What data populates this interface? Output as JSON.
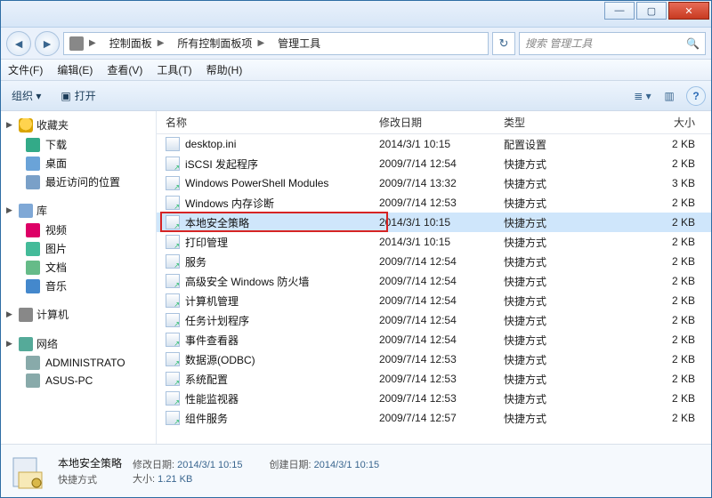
{
  "window": {
    "min_label": "—",
    "max_label": "▢",
    "close_label": "✕"
  },
  "address": {
    "root_icon": "control-panel-icon",
    "crumbs": [
      "控制面板",
      "所有控制面板项",
      "管理工具"
    ],
    "refresh_label": "↻",
    "search_placeholder": "搜索 管理工具",
    "search_icon": "🔍"
  },
  "menubar": [
    "文件(F)",
    "编辑(E)",
    "查看(V)",
    "工具(T)",
    "帮助(H)"
  ],
  "toolbar": {
    "organize": "组织 ▾",
    "open": "打开",
    "open_icon": "▣",
    "view_icon": "≣ ▾",
    "help_icon": "?"
  },
  "nav": {
    "favorites": {
      "label": "收藏夹",
      "items": [
        "下载",
        "桌面",
        "最近访问的位置"
      ]
    },
    "libraries": {
      "label": "库",
      "items": [
        "视频",
        "图片",
        "文档",
        "音乐"
      ]
    },
    "computer": {
      "label": "计算机"
    },
    "network": {
      "label": "网络",
      "items": [
        "ADMINISTRATO",
        "ASUS-PC"
      ]
    }
  },
  "columns": {
    "name": "名称",
    "date": "修改日期",
    "type": "类型",
    "size": "大小"
  },
  "files": [
    {
      "name": "desktop.ini",
      "date": "2014/3/1 10:15",
      "type": "配置设置",
      "size": "2 KB",
      "icon": "file"
    },
    {
      "name": "iSCSI 发起程序",
      "date": "2009/7/14 12:54",
      "type": "快捷方式",
      "size": "2 KB",
      "icon": "lnk"
    },
    {
      "name": "Windows PowerShell Modules",
      "date": "2009/7/14 13:32",
      "type": "快捷方式",
      "size": "3 KB",
      "icon": "lnk"
    },
    {
      "name": "Windows 内存诊断",
      "date": "2009/7/14 12:53",
      "type": "快捷方式",
      "size": "2 KB",
      "icon": "lnk"
    },
    {
      "name": "本地安全策略",
      "date": "2014/3/1 10:15",
      "type": "快捷方式",
      "size": "2 KB",
      "icon": "lnk",
      "selected": true,
      "annot": true
    },
    {
      "name": "打印管理",
      "date": "2014/3/1 10:15",
      "type": "快捷方式",
      "size": "2 KB",
      "icon": "lnk"
    },
    {
      "name": "服务",
      "date": "2009/7/14 12:54",
      "type": "快捷方式",
      "size": "2 KB",
      "icon": "lnk"
    },
    {
      "name": "高级安全 Windows 防火墙",
      "date": "2009/7/14 12:54",
      "type": "快捷方式",
      "size": "2 KB",
      "icon": "lnk"
    },
    {
      "name": "计算机管理",
      "date": "2009/7/14 12:54",
      "type": "快捷方式",
      "size": "2 KB",
      "icon": "lnk"
    },
    {
      "name": "任务计划程序",
      "date": "2009/7/14 12:54",
      "type": "快捷方式",
      "size": "2 KB",
      "icon": "lnk"
    },
    {
      "name": "事件查看器",
      "date": "2009/7/14 12:54",
      "type": "快捷方式",
      "size": "2 KB",
      "icon": "lnk"
    },
    {
      "name": "数据源(ODBC)",
      "date": "2009/7/14 12:53",
      "type": "快捷方式",
      "size": "2 KB",
      "icon": "lnk"
    },
    {
      "name": "系统配置",
      "date": "2009/7/14 12:53",
      "type": "快捷方式",
      "size": "2 KB",
      "icon": "lnk"
    },
    {
      "name": "性能监视器",
      "date": "2009/7/14 12:53",
      "type": "快捷方式",
      "size": "2 KB",
      "icon": "lnk"
    },
    {
      "name": "组件服务",
      "date": "2009/7/14 12:57",
      "type": "快捷方式",
      "size": "2 KB",
      "icon": "lnk"
    }
  ],
  "details": {
    "name": "本地安全策略",
    "type": "快捷方式",
    "date_label": "修改日期:",
    "date_value": "2014/3/1 10:15",
    "created_label": "创建日期:",
    "created_value": "2014/3/1 10:15",
    "size_label": "大小:",
    "size_value": "1.21 KB"
  }
}
